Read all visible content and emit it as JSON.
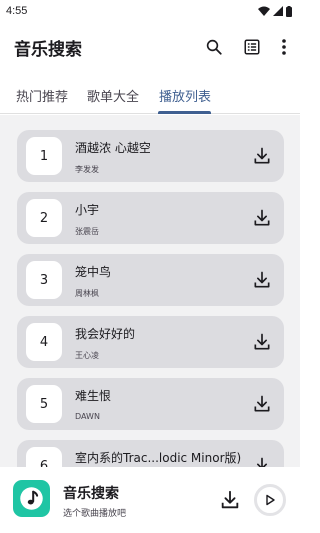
{
  "status_bar": {
    "time": "4:55"
  },
  "app_bar": {
    "title": "音乐搜索"
  },
  "tabs": [
    {
      "label": "热门推荐",
      "active": false
    },
    {
      "label": "歌单大全",
      "active": false
    },
    {
      "label": "播放列表",
      "active": true
    }
  ],
  "songs": [
    {
      "number": "1",
      "title": "酒越浓 心越空",
      "artist": "李发发"
    },
    {
      "number": "2",
      "title": "小宇",
      "artist": "张震岳"
    },
    {
      "number": "3",
      "title": "笼中鸟",
      "artist": "周林枫"
    },
    {
      "number": "4",
      "title": "我会好好的",
      "artist": "王心凌"
    },
    {
      "number": "5",
      "title": "难生恨",
      "artist": "DAWN"
    },
    {
      "number": "6",
      "title": "室内系的Trac...lodic Minor版)",
      "artist": ""
    }
  ],
  "player": {
    "title": "音乐搜索",
    "subtitle": "选个歌曲播放吧"
  },
  "colors": {
    "accent": "#3f5f90",
    "card": "#dcdce0",
    "list_bg": "#f2f2f3",
    "cover": "#1fc5a4"
  }
}
